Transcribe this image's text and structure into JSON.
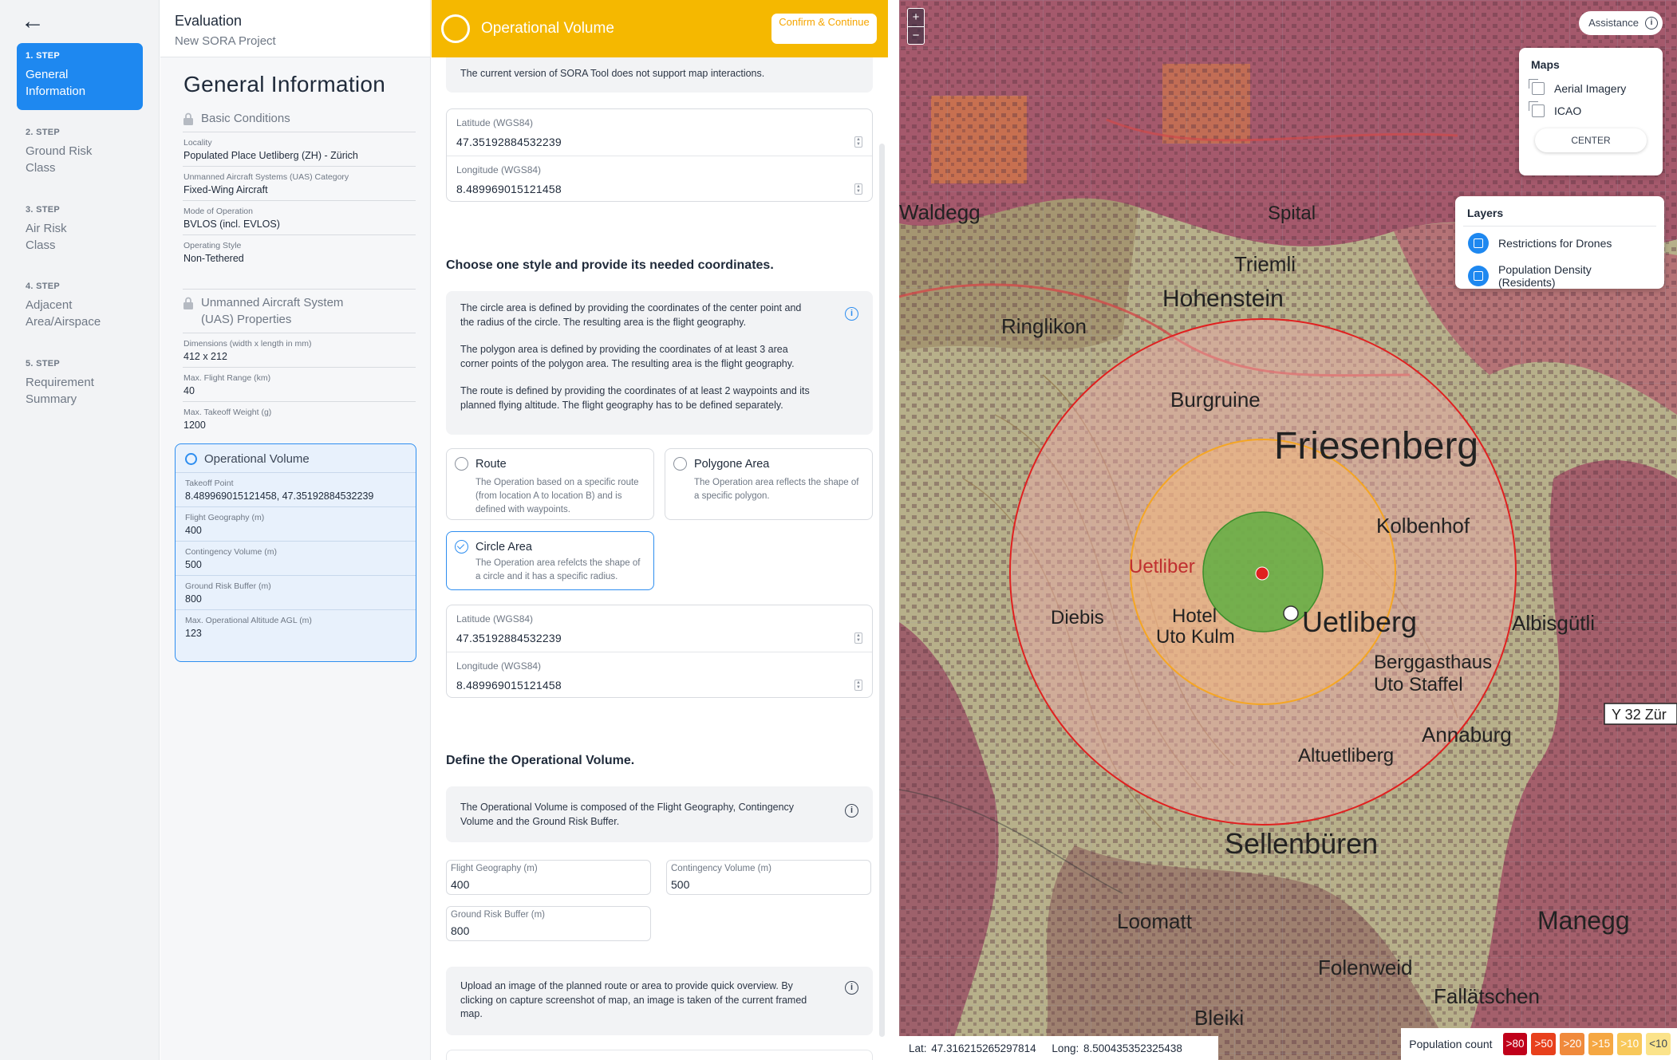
{
  "steps": {
    "back_label": "←",
    "items": [
      {
        "num": "1. STEP",
        "title": "General Information"
      },
      {
        "num": "2. STEP",
        "title": "Ground Risk Class"
      },
      {
        "num": "3. STEP",
        "title": "Air Risk Class"
      },
      {
        "num": "4. STEP",
        "title": "Adjacent Area/Airspace"
      },
      {
        "num": "5. STEP",
        "title": "Requirement Summary"
      }
    ]
  },
  "info": {
    "header_title": "Evaluation",
    "header_subtitle": "New SORA Project",
    "title": "General Information",
    "basic": {
      "heading": "Basic Conditions",
      "fields": [
        {
          "label": "Locality",
          "value": "Populated Place Uetliberg (ZH) - Zürich"
        },
        {
          "label": "Unmanned Aircraft Systems (UAS) Category",
          "value": "Fixed-Wing Aircraft"
        },
        {
          "label": "Mode of Operation",
          "value": "BVLOS (incl. EVLOS)"
        },
        {
          "label": "Operating Style",
          "value": "Non-Tethered"
        }
      ]
    },
    "uas": {
      "heading": "Unmanned Aircraft System (UAS) Properties",
      "fields": [
        {
          "label": "Dimensions (width x length in mm)",
          "value": "412 x 212"
        },
        {
          "label": "Max. Flight Range (km)",
          "value": "40"
        },
        {
          "label": "Max. Takeoff Weight (g)",
          "value": "1200"
        }
      ]
    },
    "opvol": {
      "heading": "Operational Volume",
      "fields": [
        {
          "label": "Takeoff Point",
          "value": "8.489969015121458, 47.35192884532239"
        },
        {
          "label": "Flight Geography (m)",
          "value": "400"
        },
        {
          "label": "Contingency Volume (m)",
          "value": "500"
        },
        {
          "label": "Ground Risk Buffer (m)",
          "value": "800"
        },
        {
          "label": "Max. Operational Altitude AGL (m)",
          "value": "123"
        }
      ]
    }
  },
  "form": {
    "title": "Operational Volume",
    "confirm_label": "Confirm & Continue",
    "map_note": "The current version of SORA Tool does not support map interactions.",
    "takeoff": {
      "lat_label": "Latitude (WGS84)",
      "lat_value": "47.35192884532239",
      "lon_label": "Longitude (WGS84)",
      "lon_value": "8.489969015121458"
    },
    "style_heading": "Choose one style and provide its needed coordinates.",
    "style_info": [
      "The circle area is defined by providing the coordinates of the center point and the radius of the circle. The resulting area is the flight geography.",
      "The polygon area is defined by providing the coordinates of at least 3 area corner points of the polygon area. The resulting area is the flight geography.",
      "The route is defined by providing the coordinates of at least 2 waypoints and its planned flying altitude. The flight geography has to be defined separately."
    ],
    "options": [
      {
        "title": "Route",
        "desc": "The Operation based on a specific route (from location A to location B) and is defined with waypoints."
      },
      {
        "title": "Polygone Area",
        "desc": "The Operation area reflects the shape of a specific polygon."
      },
      {
        "title": "Circle Area",
        "desc": "The Operation area refelcts the shape of a circle and it has a specific radius."
      }
    ],
    "center": {
      "lat_label": "Latitude (WGS84)",
      "lat_value": "47.35192884532239",
      "lon_label": "Longitude (WGS84)",
      "lon_value": "8.489969015121458"
    },
    "opvol_heading": "Define the Operational Volume.",
    "opvol_info": "The Operational Volume is composed of the Flight Geography, Contingency Volume and the Ground Risk Buffer.",
    "fg_label": "Flight Geography (m)",
    "fg_value": "400",
    "cv_label": "Contingency Volume (m)",
    "cv_value": "500",
    "grb_label": "Ground Risk Buffer (m)",
    "grb_value": "800",
    "upload_info": "Upload an image of the planned route or area to provide quick overview. By clicking on capture screenshot of map, an image is taken of the current framed map."
  },
  "map": {
    "zoom_in": "+",
    "zoom_out": "−",
    "assistance_label": "Assistance",
    "maps_heading": "Maps",
    "maps_items": [
      "Aerial Imagery",
      "ICAO"
    ],
    "center_label": "CENTER",
    "layers_heading": "Layers",
    "layers_items": [
      "Restrictions for Drones",
      "Population Density (Residents)"
    ],
    "lat_readout": "Lat: 47.316215265297814",
    "lon_readout": "Long: 8.500435352325438",
    "legend_label": "Population count",
    "legend_items": [
      {
        "label": ">80",
        "color": "#c0001a"
      },
      {
        "label": ">50",
        "color": "#e8401c"
      },
      {
        "label": ">20",
        "color": "#f08a3c"
      },
      {
        "label": ">15",
        "color": "#f5a742"
      },
      {
        "label": ">10",
        "color": "#f8c85a"
      },
      {
        "label": "<10",
        "color": "#fbe38a"
      }
    ],
    "place_labels": [
      "Hohenstein",
      "Ringlikon",
      "Burgruine",
      "Friesenberg",
      "Kolbenhof",
      "Uetliberg",
      "Diebis",
      "Hotel Uto Kulm",
      "Uetliberg",
      "Berggasthaus Uto Staffel",
      "Annaburg",
      "Altuetliberg",
      "Albisgütli",
      "Sellenbüren",
      "Loomatt",
      "Folenweid",
      "Manegg",
      "Bleiki",
      "Fallätschen",
      "Triemli",
      "Waldegg",
      "Spital",
      "32 Zür"
    ],
    "colors": {
      "flight": "#3cb043",
      "contingency": "#f5a623",
      "buffer": "#e02020",
      "accent": "#1e88f0",
      "header": "#f5b800"
    }
  }
}
